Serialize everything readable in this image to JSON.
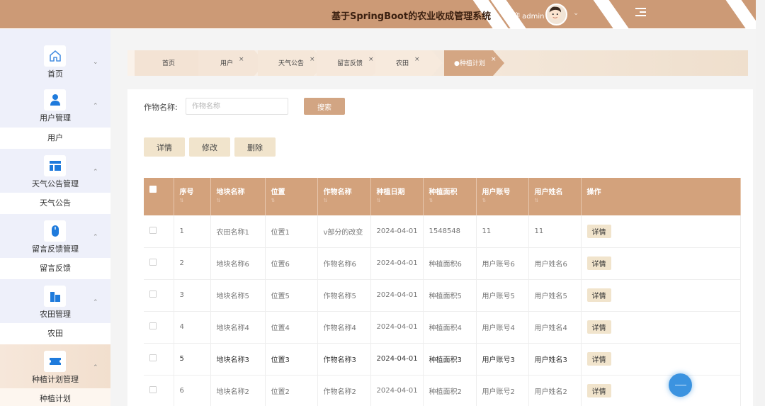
{
  "header": {
    "title": "基于SpringBoot的农业收成管理系统",
    "welcome": "欢迎 admin",
    "user_chevron": "⌄"
  },
  "sidebar": {
    "arrows": {
      "down": "⌄",
      "up": "⌃"
    },
    "menus": [
      {
        "label": "首页",
        "icon": "home-icon",
        "sub": ""
      },
      {
        "label": "用户管理",
        "icon": "user-icon",
        "sub": "用户"
      },
      {
        "label": "天气公告管理",
        "icon": "layout-icon",
        "sub": "天气公告"
      },
      {
        "label": "留言反馈管理",
        "icon": "mouse-icon",
        "sub": "留言反馈"
      },
      {
        "label": "农田管理",
        "icon": "building-icon",
        "sub": "农田"
      },
      {
        "label": "种植计划管理",
        "icon": "ticket-icon",
        "sub": "种植计划"
      }
    ]
  },
  "breadcrumbs": {
    "close": "×",
    "items": [
      "首页",
      "用户",
      "天气公告",
      "留言反馈",
      "农田",
      "●种植计划"
    ]
  },
  "search": {
    "label": "作物名称:",
    "placeholder": "作物名称",
    "button": "搜索"
  },
  "actions": {
    "detail": "详情",
    "edit": "修改",
    "delete": "删除"
  },
  "table": {
    "sort_mark": "⇅",
    "headers": [
      "序号",
      "地块名称",
      "位置",
      "作物名称",
      "种植日期",
      "种植面积",
      "用户账号",
      "用户姓名",
      "操作"
    ],
    "row_action": "详情",
    "rows": [
      [
        "1",
        "农田名称1",
        "位置1",
        "v部分的改变",
        "2024-04-01",
        "1548548",
        "11",
        "11"
      ],
      [
        "2",
        "地块名称6",
        "位置6",
        "作物名称6",
        "2024-04-01",
        "种植面积6",
        "用户账号6",
        "用户姓名6"
      ],
      [
        "3",
        "地块名称5",
        "位置5",
        "作物名称5",
        "2024-04-01",
        "种植面积5",
        "用户账号5",
        "用户姓名5"
      ],
      [
        "4",
        "地块名称4",
        "位置4",
        "作物名称4",
        "2024-04-01",
        "种植面积4",
        "用户账号4",
        "用户姓名4"
      ],
      [
        "5",
        "地块名称3",
        "位置3",
        "作物名称3",
        "2024-04-01",
        "种植面积3",
        "用户账号3",
        "用户姓名3"
      ],
      [
        "6",
        "地块名称2",
        "位置2",
        "作物名称2",
        "2024-04-01",
        "种植面积2",
        "用户账号2",
        "用户姓名2"
      ]
    ]
  },
  "colors": {
    "accent": "#cc9a76",
    "button": "#f1e4cc",
    "float": "#3b93e0"
  }
}
